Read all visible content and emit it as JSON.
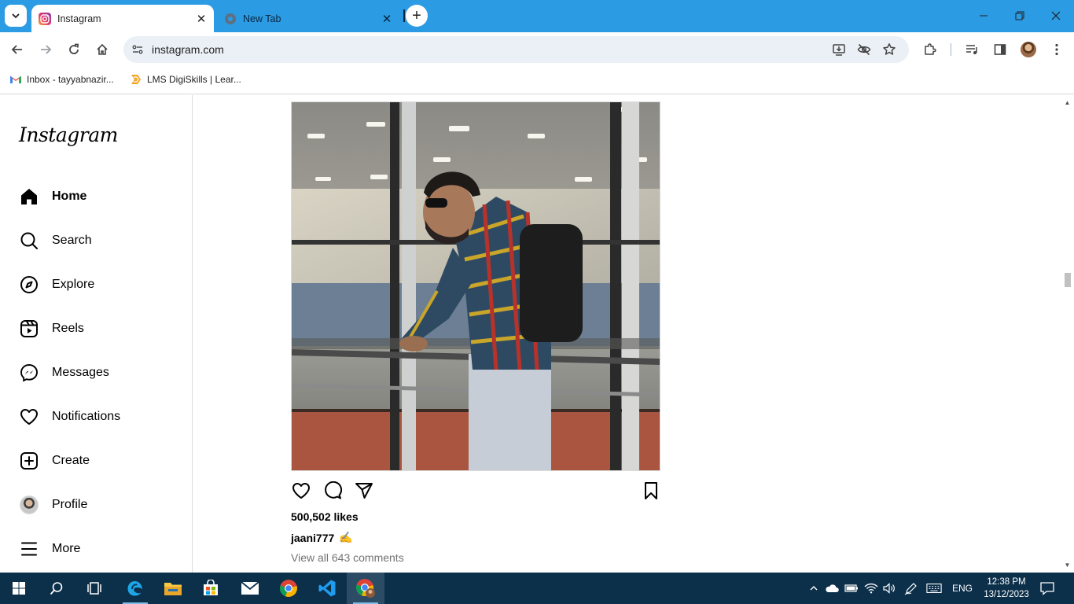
{
  "browser": {
    "tabs": [
      {
        "title": "Instagram",
        "close": "✕"
      },
      {
        "title": "New Tab",
        "close": "✕"
      }
    ],
    "newtab_label": "+",
    "url": "instagram.com",
    "bookmarks": [
      {
        "label": "Inbox - tayyabnazir..."
      },
      {
        "label": "LMS DigiSkills | Lear..."
      }
    ]
  },
  "instagram": {
    "logo": "Instagram",
    "nav": [
      {
        "label": "Home",
        "icon": "home-icon"
      },
      {
        "label": "Search",
        "icon": "search-icon"
      },
      {
        "label": "Explore",
        "icon": "compass-icon"
      },
      {
        "label": "Reels",
        "icon": "reels-icon"
      },
      {
        "label": "Messages",
        "icon": "messenger-icon"
      },
      {
        "label": "Notifications",
        "icon": "heart-icon"
      },
      {
        "label": "Create",
        "icon": "plus-square-icon"
      },
      {
        "label": "Profile",
        "icon": "avatar"
      },
      {
        "label": "More",
        "icon": "menu-icon"
      }
    ],
    "post": {
      "likes": "500,502 likes",
      "username": "jaani777",
      "caption_emoji": "✍",
      "comments": "View all 643 comments"
    }
  },
  "taskbar": {
    "time": "12:38 PM",
    "date": "13/12/2023",
    "language": "ENG"
  },
  "colors": {
    "chrome_frame": "#2b9be3",
    "omnibox": "#ebf0f6",
    "taskbar": "#0c2f4a"
  }
}
